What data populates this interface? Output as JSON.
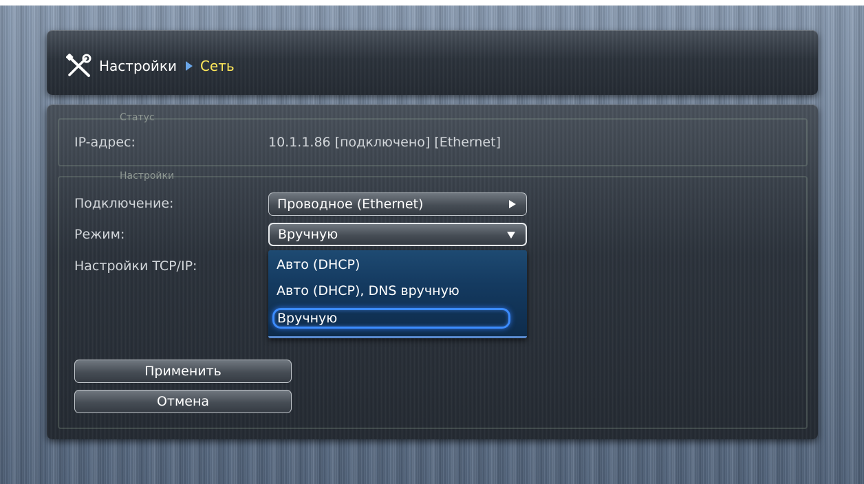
{
  "breadcrumb": {
    "root": "Настройки",
    "current": "Сеть"
  },
  "status_section": {
    "legend": "Статус",
    "ip_label": "IP-адрес:",
    "ip_value": "10.1.1.86 [подключено] [Ethernet]"
  },
  "settings_section": {
    "legend": "Настройки",
    "connection_label": "Подключение:",
    "connection_value": "Проводное (Ethernet)",
    "mode_label": "Режим:",
    "mode_value": "Вручную",
    "tcpip_label": "Настройки TCP/IP:"
  },
  "mode_dropdown": {
    "options": [
      "Авто (DHCP)",
      "Авто (DHCP), DNS вручную",
      "Вручную"
    ],
    "selected": "Вручную"
  },
  "buttons": {
    "apply": "Применить",
    "cancel": "Отмена"
  },
  "colors": {
    "breadcrumb_current": "#ffe85a",
    "dropdown_bg": "#143a60",
    "focus_highlight": "#3c8cff"
  },
  "icons": {
    "breadcrumb": "tools-icon",
    "separator": "triangle-right-icon",
    "connection_select": "triangle-right-icon",
    "mode_select": "triangle-down-icon"
  }
}
